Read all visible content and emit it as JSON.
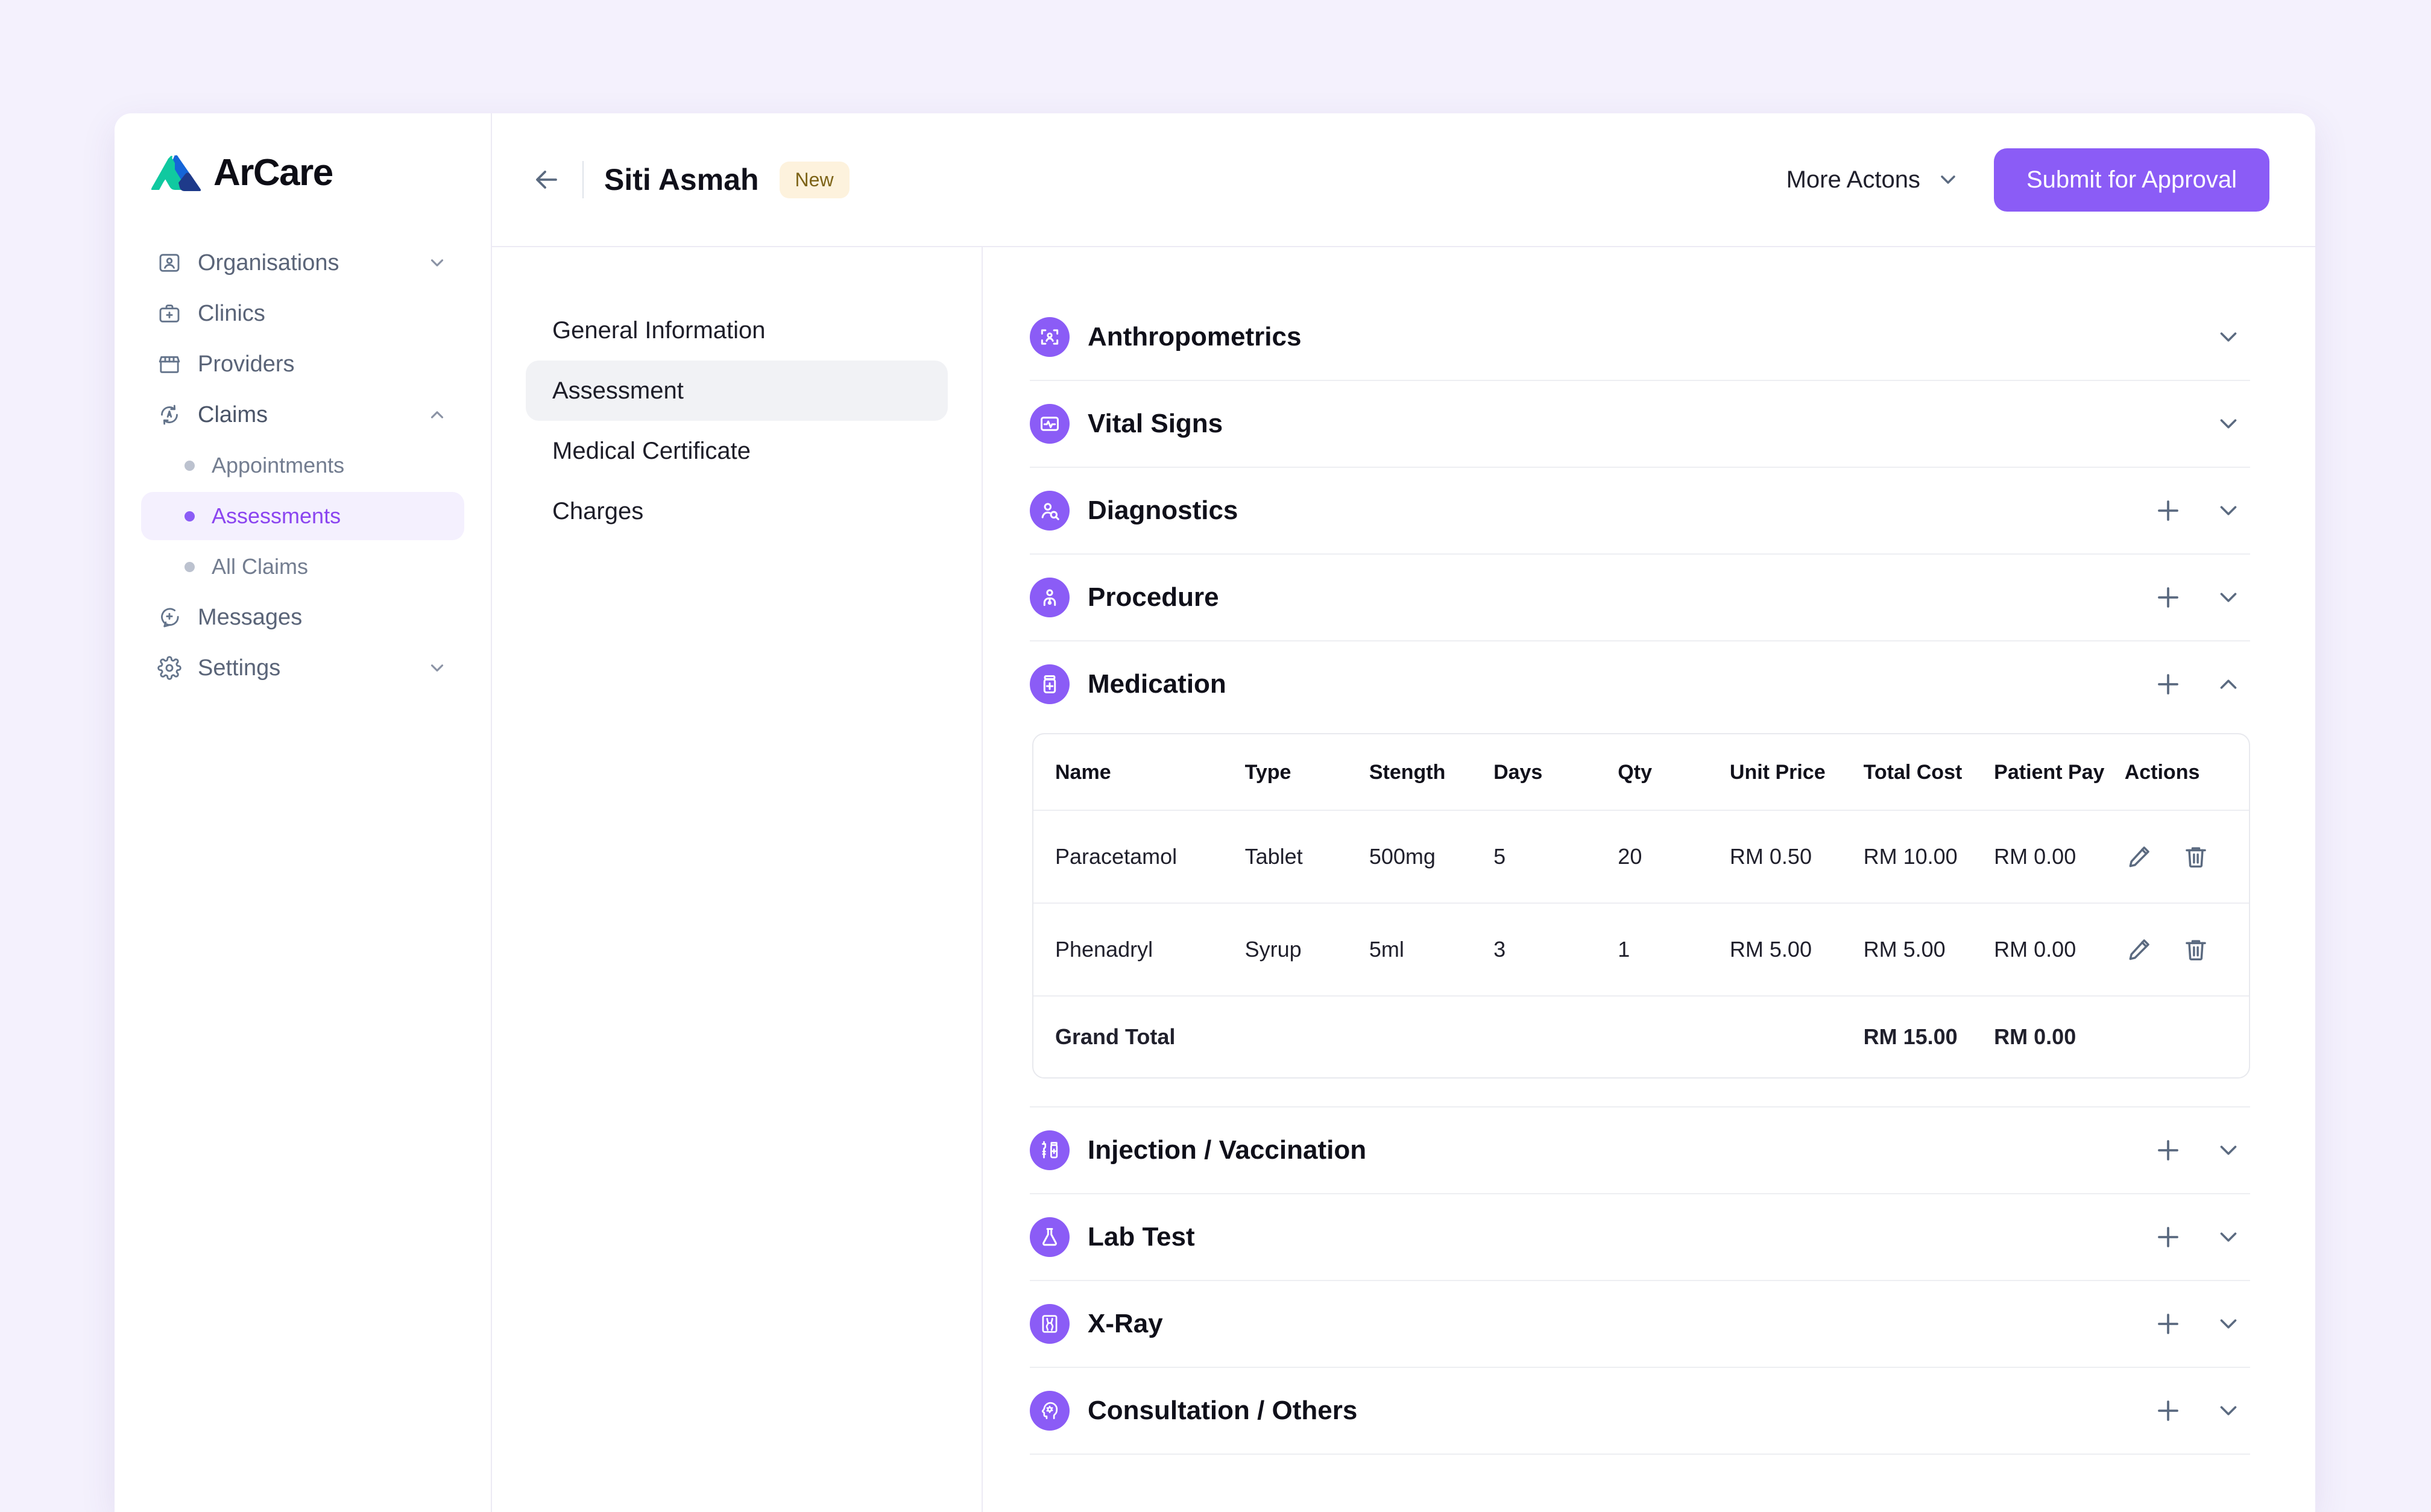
{
  "brand": {
    "name": "ArCare"
  },
  "sidebar": {
    "items": [
      {
        "label": "Organisations",
        "icon": "contact-card-icon",
        "chevron": "chevron-down-icon"
      },
      {
        "label": "Clinics",
        "icon": "medical-bag-icon",
        "chevron": ""
      },
      {
        "label": "Providers",
        "icon": "storefront-icon",
        "chevron": ""
      },
      {
        "label": "Claims",
        "icon": "claims-refresh-icon",
        "chevron": "chevron-up-icon"
      }
    ],
    "claims_children": [
      {
        "label": "Appointments",
        "active": false
      },
      {
        "label": "Assessments",
        "active": true
      },
      {
        "label": "All Claims",
        "active": false
      }
    ],
    "bottom_items": [
      {
        "label": "Messages",
        "icon": "message-plus-icon",
        "chevron": ""
      },
      {
        "label": "Settings",
        "icon": "gear-icon",
        "chevron": "chevron-down-icon"
      }
    ]
  },
  "header": {
    "back_icon": "arrow-left-icon",
    "patient_name": "Siti Asmah",
    "status_badge": "New",
    "more_actions_label": "More Actons",
    "submit_label": "Submit for Approval"
  },
  "subnav": {
    "items": [
      {
        "label": "General Information",
        "active": false
      },
      {
        "label": "Assessment",
        "active": true
      },
      {
        "label": "Medical Certificate",
        "active": false
      },
      {
        "label": "Charges",
        "active": false
      }
    ]
  },
  "sections": {
    "anthropometrics": {
      "title": "Anthropometrics",
      "icon": "person-scan-icon",
      "has_add": false,
      "expanded": false
    },
    "vital_signs": {
      "title": "Vital Signs",
      "icon": "heartbeat-monitor-icon",
      "has_add": false,
      "expanded": false
    },
    "diagnostics": {
      "title": "Diagnostics",
      "icon": "person-search-icon",
      "has_add": true,
      "expanded": false
    },
    "procedure": {
      "title": "Procedure",
      "icon": "doctor-icon",
      "has_add": true,
      "expanded": false
    },
    "medication": {
      "title": "Medication",
      "icon": "pill-bottle-icon",
      "has_add": true,
      "expanded": true
    },
    "injection": {
      "title": "Injection / Vaccination",
      "icon": "syringe-vial-icon",
      "has_add": true,
      "expanded": false
    },
    "lab_test": {
      "title": "Lab Test",
      "icon": "lab-flask-icon",
      "has_add": true,
      "expanded": false
    },
    "xray": {
      "title": "X-Ray",
      "icon": "xray-bone-icon",
      "has_add": true,
      "expanded": false
    },
    "consultation": {
      "title": "Consultation / Others",
      "icon": "head-gear-icon",
      "has_add": true,
      "expanded": false
    }
  },
  "medication_table": {
    "columns": [
      "Name",
      "Type",
      "Stength",
      "Days",
      "Qty",
      "Unit Price",
      "Total Cost",
      "Patient Pay",
      "Actions"
    ],
    "rows": [
      {
        "name": "Paracetamol",
        "type": "Tablet",
        "strength": "500mg",
        "days": "5",
        "qty": "20",
        "unit_price": "RM 0.50",
        "total_cost": "RM 10.00",
        "patient_pay": "RM 0.00",
        "edit_icon": "pencil-icon",
        "delete_icon": "trash-icon"
      },
      {
        "name": "Phenadryl",
        "type": "Syrup",
        "strength": "5ml",
        "days": "3",
        "qty": "1",
        "unit_price": "RM 5.00",
        "total_cost": "RM 5.00",
        "patient_pay": "RM 0.00",
        "edit_icon": "pencil-icon",
        "delete_icon": "trash-icon"
      }
    ],
    "grand_total": {
      "label": "Grand Total",
      "total_cost": "RM 15.00",
      "patient_pay": "RM 0.00"
    }
  },
  "colors": {
    "accent_purple": "#8b5cf6",
    "page_background": "#f4f1fd",
    "badge_background": "#fdf2dd",
    "badge_text": "#7d6317",
    "logo_green": "#10c9a0",
    "logo_blue": "#1565d8",
    "logo_navy": "#1e3a8a"
  }
}
